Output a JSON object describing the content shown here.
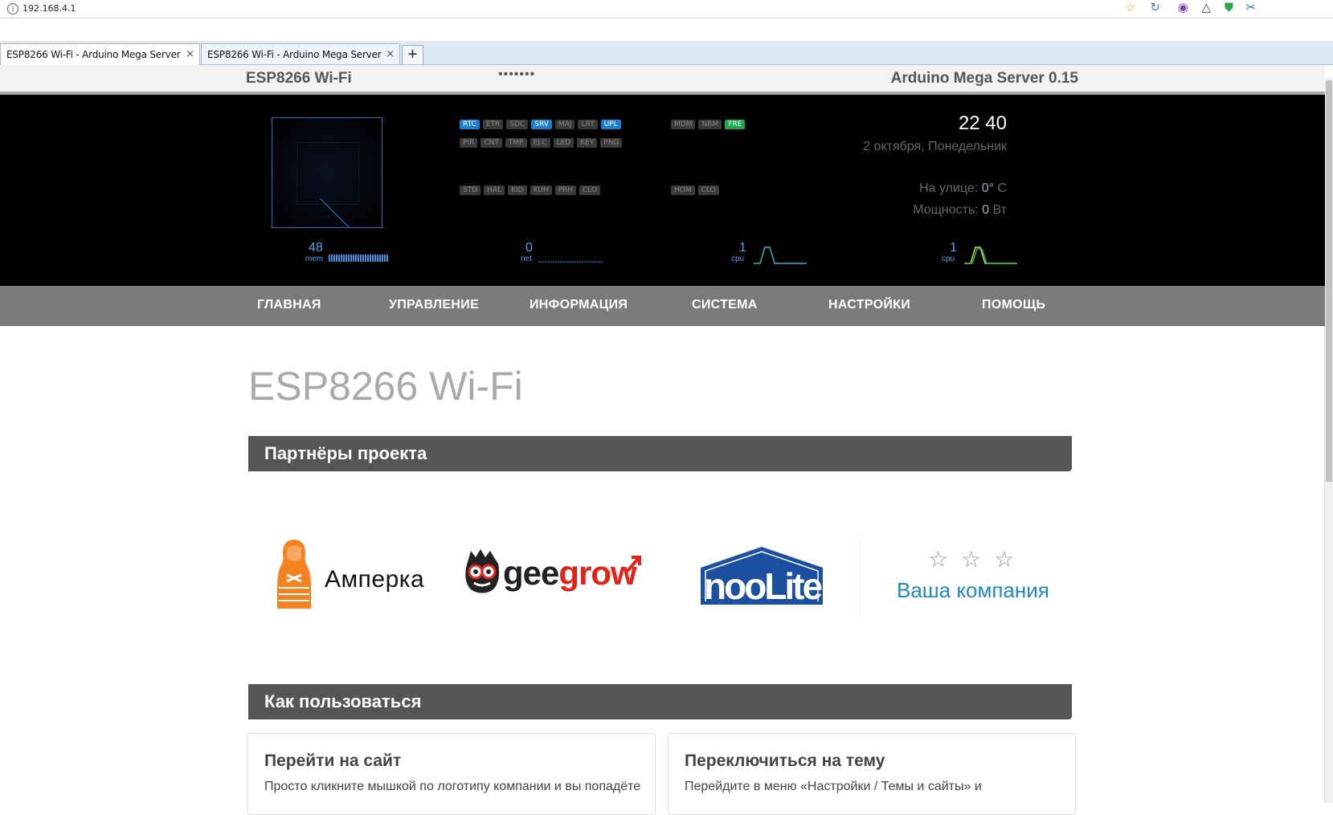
{
  "browser": {
    "url": "192.168.4.1",
    "tabs": [
      {
        "label": "ESP8266 Wi-Fi - Arduino Mega Server",
        "active": true
      },
      {
        "label": "ESP8266 Wi-Fi - Arduino Mega Server",
        "active": false
      }
    ],
    "new_tab_label": "+",
    "close_label": "×"
  },
  "header": {
    "left": "ESP8266 Wi-Fi",
    "middle": "•••••••",
    "right": "Arduino Mega Server 0.15"
  },
  "dashboard": {
    "modules_row1": [
      {
        "label": "RTC",
        "state": "on"
      },
      {
        "label": "ETR",
        "state": "off"
      },
      {
        "label": "SDC",
        "state": "off"
      },
      {
        "label": "SRV",
        "state": "on"
      },
      {
        "label": "MAJ",
        "state": "off"
      },
      {
        "label": "LRT",
        "state": "off"
      },
      {
        "label": "UPL",
        "state": "on"
      }
    ],
    "modules_row2": [
      {
        "label": "PIR",
        "state": "off"
      },
      {
        "label": "CNT",
        "state": "off"
      },
      {
        "label": "TMP",
        "state": "off"
      },
      {
        "label": "ELC",
        "state": "off"
      },
      {
        "label": "LED",
        "state": "off"
      },
      {
        "label": "KEY",
        "state": "off"
      },
      {
        "label": "PNG",
        "state": "off"
      }
    ],
    "modules_row3": [
      {
        "label": "STD",
        "state": "off"
      },
      {
        "label": "HAL",
        "state": "off"
      },
      {
        "label": "KID",
        "state": "off"
      },
      {
        "label": "KUH",
        "state": "off"
      },
      {
        "label": "PRH",
        "state": "off"
      },
      {
        "label": "CLO",
        "state": "off"
      }
    ],
    "modes_row1": [
      {
        "label": "MDM",
        "state": "off"
      },
      {
        "label": "NRM",
        "state": "off"
      },
      {
        "label": "FRE",
        "state": "green"
      }
    ],
    "modes_row3": [
      {
        "label": "HOM",
        "state": "off"
      },
      {
        "label": "CLO",
        "state": "off"
      }
    ],
    "time": "22 40",
    "date": "2 октября, Понедельник",
    "outside_label": "На улице:",
    "outside_value": "0°",
    "outside_unit": "C",
    "power_label": "Мощность:",
    "power_value": "0",
    "power_unit": "Вт",
    "meters": [
      {
        "value": "48",
        "label": "mem"
      },
      {
        "value": "0",
        "label": "net"
      },
      {
        "value": "1",
        "label": "cpu"
      },
      {
        "value": "1",
        "label": "cpu"
      }
    ]
  },
  "nav": {
    "items": [
      "ГЛАВНАЯ",
      "УПРАВЛЕНИЕ",
      "ИНФОРМАЦИЯ",
      "СИСТЕМА",
      "НАСТРОЙКИ",
      "ПОМОЩЬ"
    ]
  },
  "main": {
    "title": "ESP8266 Wi-Fi",
    "partners_title": "Партнёры проекта",
    "partners": {
      "amperka": "Амперка",
      "geegrow_gee": "gee",
      "geegrow_grow": "grow",
      "noolite": "nooLite",
      "your_company": "Ваша компания",
      "stars": "☆☆☆"
    },
    "howto_title": "Как пользоваться",
    "cards": [
      {
        "title": "Перейти на сайт",
        "text": "Просто кликните мышкой по логотипу компании и вы попадёте"
      },
      {
        "title": "Переключиться на тему",
        "text": "Перейдите в меню «Настройки / Темы и сайты» и"
      }
    ]
  },
  "colors": {
    "accent_blue": "#1a7fd0",
    "link_blue": "#1e88c6",
    "green": "#1aa84a",
    "nav_bg": "#7a7a7a",
    "section_bg": "#555555",
    "amperka_orange": "#f58220",
    "geegrow_red": "#e2231a",
    "noolite_blue": "#1b4fa0"
  }
}
